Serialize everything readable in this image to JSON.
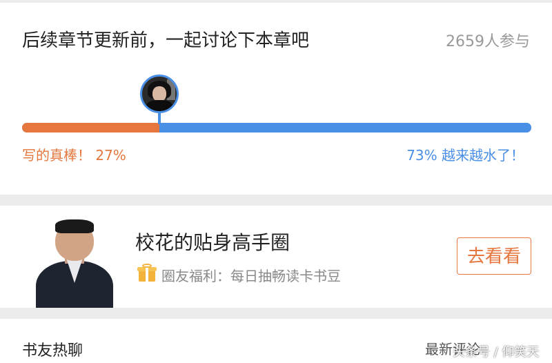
{
  "poll": {
    "title": "后续章节更新前，一起讨论下本章吧",
    "participants": "2659人参与",
    "left": {
      "label": "写的真棒！ 27%",
      "percent": 27,
      "color": "#e5773e"
    },
    "right": {
      "label": "73% 越来越水了！",
      "percent": 73,
      "color": "#4a8fe6"
    }
  },
  "circle": {
    "title": "校花的贴身高手圈",
    "benefit": "圈友福利：每日抽畅读卡书豆",
    "button_label": "去看看",
    "accent": "#e5773e"
  },
  "chat": {
    "title": "书友热聊",
    "latest": "最新评论"
  },
  "watermark": "头条号 / 仰笑天"
}
